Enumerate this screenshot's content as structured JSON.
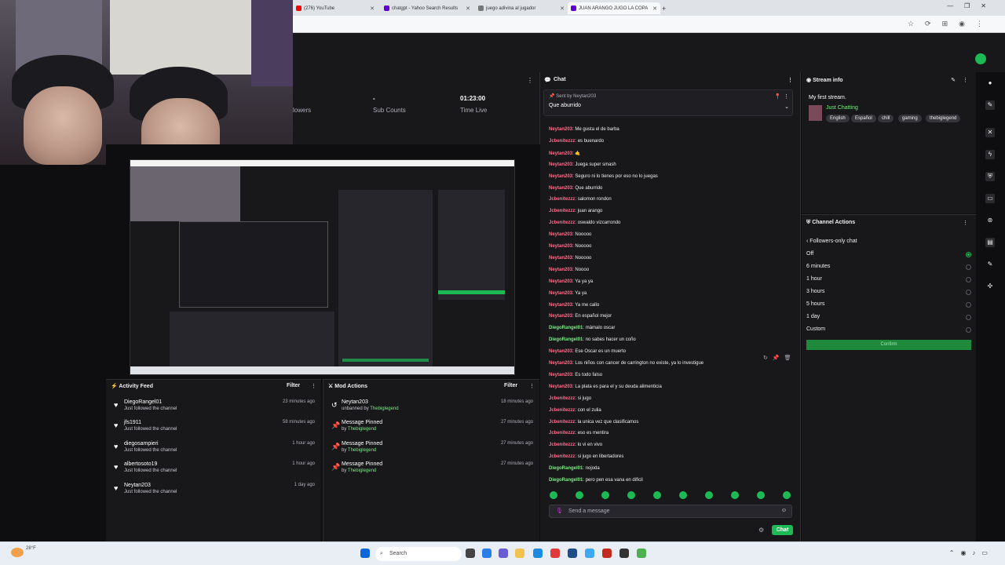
{
  "browser": {
    "tabs": [
      {
        "label": "(276) YouTube",
        "color": "#ff0000"
      },
      {
        "label": "chatgpt - Yahoo Search Results",
        "color": "#6001d2"
      },
      {
        "label": "juego adivina al jugador",
        "color": "#777777"
      },
      {
        "label": "JUAN ARANGO JUGO LA COPA",
        "color": "#6001d2"
      }
    ],
    "new_tab": "+"
  },
  "stats": {
    "followers_label": "lowers",
    "subs_value": "-",
    "subs_label": "Sub Counts",
    "time_value": "01:23:00",
    "time_label": "Time Live"
  },
  "activity_feed": {
    "title": "Activity Feed",
    "filter": "Filter",
    "items": [
      {
        "name": "DiegoRangel01",
        "sub": "Just followed the channel",
        "time": "23 minutes ago"
      },
      {
        "name": "jfs1911",
        "sub": "Just followed the channel",
        "time": "58 minutes ago"
      },
      {
        "name": "diegosampieri",
        "sub": "Just followed the channel",
        "time": "1 hour ago"
      },
      {
        "name": "albertosoto19",
        "sub": "Just followed the channel",
        "time": "1 hour ago"
      },
      {
        "name": "Neytan203",
        "sub": "Just followed the channel",
        "time": "1 day ago"
      }
    ]
  },
  "mod_actions": {
    "title": "Mod Actions",
    "filter": "Filter",
    "items": [
      {
        "name": "Neytan203",
        "sub_prefix": "unbanned by",
        "by": "Thebiglegend",
        "time": "18 minutes ago"
      },
      {
        "name": "Message Pinned",
        "sub_prefix": "by",
        "by": "Thebiglegend",
        "time": "27 minutes ago"
      },
      {
        "name": "Message Pinned",
        "sub_prefix": "by",
        "by": "Thebiglegend",
        "time": "27 minutes ago"
      },
      {
        "name": "Message Pinned",
        "sub_prefix": "by",
        "by": "Thebiglegend",
        "time": "27 minutes ago"
      }
    ]
  },
  "chat": {
    "title": "Chat",
    "pinned_by": "Sent by Neytan203",
    "pinned_message": "Que aburrido",
    "messages": [
      {
        "user": "Neytan203",
        "color": "#ff6b8b",
        "text": "Me gusta el de barba"
      },
      {
        "user": "Jcbenitezzz",
        "color": "#ff6b8b",
        "text": "es buenardo"
      },
      {
        "user": "Neytan203",
        "color": "#ff6b8b",
        "text": "🤙"
      },
      {
        "user": "Neytan203",
        "color": "#ff6b8b",
        "text": "Juega super smash"
      },
      {
        "user": "Neytan203",
        "color": "#ff6b8b",
        "text": "Seguro ni lo tienes por eso no lo juegas"
      },
      {
        "user": "Neytan203",
        "color": "#ff6b8b",
        "text": "Que aburrido"
      },
      {
        "user": "Jcbenitezzz",
        "color": "#ff6b8b",
        "text": "salomon rondon"
      },
      {
        "user": "Jcbenitezzz",
        "color": "#ff6b8b",
        "text": "juan arango"
      },
      {
        "user": "Jcbenitezzz",
        "color": "#ff6b8b",
        "text": "oswaldo vizcarrondo"
      },
      {
        "user": "Neytan203",
        "color": "#ff6b8b",
        "text": "Nooooo"
      },
      {
        "user": "Neytan203",
        "color": "#ff6b8b",
        "text": "Nooooo"
      },
      {
        "user": "Neytan203",
        "color": "#ff6b8b",
        "text": "Nooooo"
      },
      {
        "user": "Neytan203",
        "color": "#ff6b8b",
        "text": "Noooo"
      },
      {
        "user": "Neytan203",
        "color": "#ff6b8b",
        "text": "Ya ya ya"
      },
      {
        "user": "Neytan203",
        "color": "#ff6b8b",
        "text": "Ya ya"
      },
      {
        "user": "Neytan203",
        "color": "#ff6b8b",
        "text": "Ya me callo"
      },
      {
        "user": "Neytan203",
        "color": "#ff6b8b",
        "text": "En español mejor"
      },
      {
        "user": "DiegoRangel01",
        "color": "#7ee787",
        "text": "mámalo oscar"
      },
      {
        "user": "DiegoRangel01",
        "color": "#7ee787",
        "text": "no sabes hacer un coño"
      },
      {
        "user": "Neytan203",
        "color": "#ff6b8b",
        "text": "Ese Oscar es un muerto"
      },
      {
        "user": "Neytan203",
        "color": "#ff6b8b",
        "text": "Los niños con cancer de carrington no existe, ya lo investigue"
      },
      {
        "user": "Neytan203",
        "color": "#ff6b8b",
        "text": "Es todo falso"
      },
      {
        "user": "Neytan203",
        "color": "#ff6b8b",
        "text": "La plata es para el y su deuda alimenticia"
      },
      {
        "user": "Jcbenitezzz",
        "color": "#ff6b8b",
        "text": "si jugo"
      },
      {
        "user": "Jcbenitezzz",
        "color": "#ff6b8b",
        "text": "con el zulia"
      },
      {
        "user": "Jcbenitezzz",
        "color": "#ff6b8b",
        "text": "la unica vez que clasificamos"
      },
      {
        "user": "Jcbenitezzz",
        "color": "#ff6b8b",
        "text": "eso es mentira"
      },
      {
        "user": "Jcbenitezzz",
        "color": "#ff6b8b",
        "text": "lo vi en vivo"
      },
      {
        "user": "Jcbenitezzz",
        "color": "#ff6b8b",
        "text": "si jugo en libertadores"
      },
      {
        "user": "DiegoRangel01",
        "color": "#7ee787",
        "text": "nojoda"
      },
      {
        "user": "DiegoRangel01",
        "color": "#7ee787",
        "text": "pero pen esa vana en dificil"
      }
    ],
    "input_placeholder": "Send a message",
    "send_label": "Chat"
  },
  "stream_info": {
    "title": "Stream info",
    "stream_title": "My first stream.",
    "category": "Just Chatting",
    "tags": [
      "English",
      "Español",
      "chill",
      "gaming",
      "thebiglegend"
    ]
  },
  "channel_actions": {
    "title": "Channel Actions",
    "subtitle": "Followers-only chat",
    "options": [
      "Off",
      "6 minutes",
      "1 hour",
      "3 hours",
      "5 hours",
      "1 day",
      "Custom"
    ],
    "selected": "Off",
    "confirm": "Confirm"
  },
  "taskbar": {
    "search": "Search",
    "weather": "28°F"
  },
  "colors": {
    "accent": "#1db954",
    "panel": "#18181b",
    "background": "#0e0e10"
  }
}
